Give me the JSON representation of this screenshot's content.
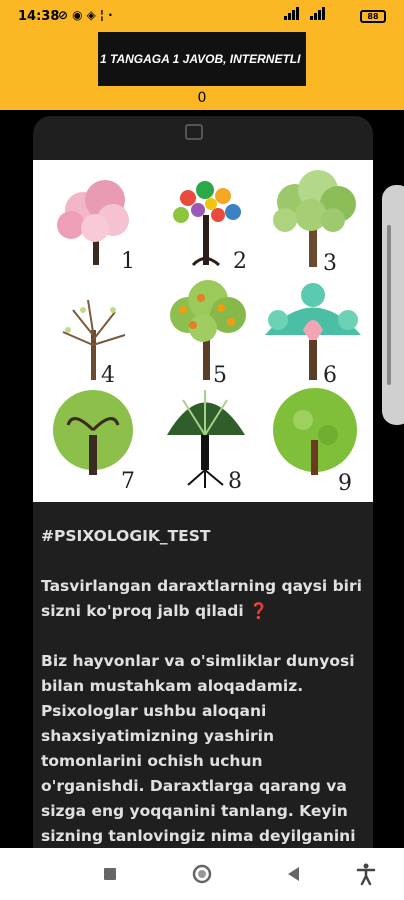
{
  "status_bar": {
    "time": "14:38",
    "battery": "88",
    "icons": [
      "data-saver-icon",
      "telegram-icon",
      "vpn-icon",
      "usb-icon",
      "dot-icon"
    ],
    "signal_icons": [
      "wifi-signal-icon",
      "cell-signal-icon"
    ]
  },
  "banner": {
    "marquee": "1 TANGAGA 1 JAVOB, INTERNETLI",
    "counter": "0"
  },
  "post": {
    "tree_labels": [
      "1",
      "2",
      "3",
      "4",
      "5",
      "6",
      "7",
      "8",
      "9"
    ],
    "hashtag": "#PSIXOLOGIK_TEST",
    "question": "Tasvirlangan daraxtlarning qaysi biri sizni ko'proq jalb qiladi ❓",
    "body": "Biz hayvonlar va o'simliklar dunyosi bilan mustahkam aloqadamiz. Psixologlar ushbu aloqani shaxsiyatimizning yashirin tomonlarini ochish uchun o'rganishdi. Daraxtlarga qarang va sizga eng yoqqanini tanlang. Keyin sizning tanlovingiz nima deyilganini"
  },
  "colors": {
    "banner": "#fbb724",
    "card": "#1f1f1f"
  }
}
